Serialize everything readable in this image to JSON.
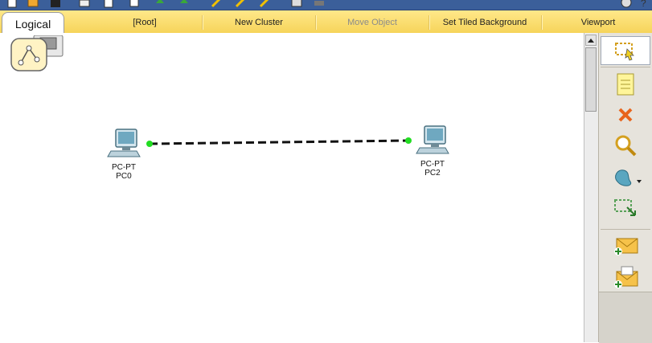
{
  "nav": {
    "logical_tab": "Logical",
    "root": "[Root]",
    "new_cluster": "New Cluster",
    "move_object": "Move Object",
    "set_tiled_background": "Set Tiled Background",
    "viewport": "Viewport"
  },
  "devices": [
    {
      "type": "PC-PT",
      "name": "PC0"
    },
    {
      "type": "PC-PT",
      "name": "PC2"
    }
  ],
  "colors": {
    "nav_bar": "#f6d45a",
    "link_dot": "#22dd22",
    "cable": "#111111"
  },
  "icons": {
    "tools": [
      "select-icon",
      "note-icon",
      "delete-icon",
      "inspect-icon",
      "draw-shape-icon",
      "resize-icon",
      "add-simple-pdu-icon",
      "add-complex-pdu-icon"
    ]
  }
}
